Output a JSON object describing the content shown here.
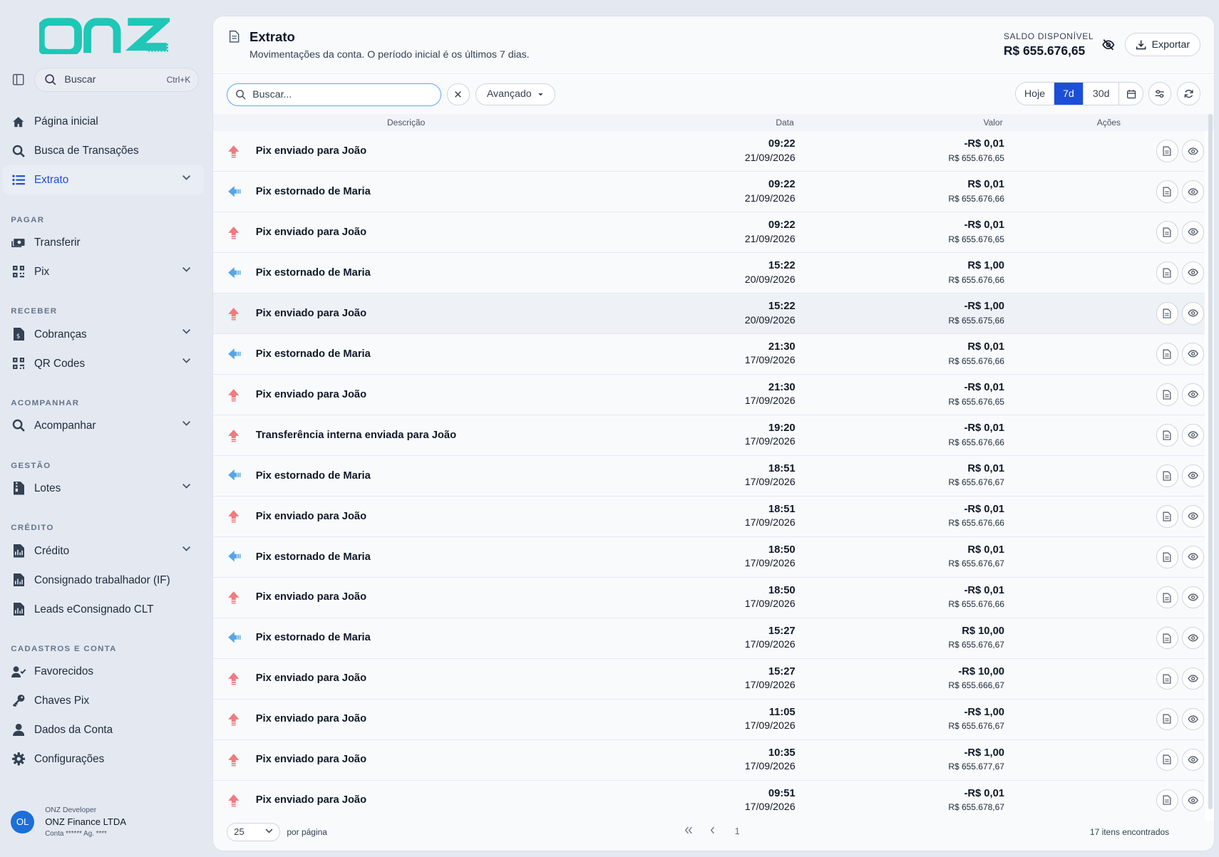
{
  "app": {
    "logo_text": "onz",
    "brand_color": "#1fc7b6",
    "accent_color": "#1d4ed8"
  },
  "sidebar": {
    "search_label": "Buscar",
    "search_shortcut": "Ctrl+K",
    "items_top": [
      {
        "label": "Página inicial",
        "icon": "home-icon"
      },
      {
        "label": "Busca de Transações",
        "icon": "search-icon"
      },
      {
        "label": "Extrato",
        "icon": "list-icon",
        "active": true,
        "expandable": true
      }
    ],
    "sections": [
      {
        "title": "PAGAR",
        "items": [
          {
            "label": "Transferir",
            "icon": "money-transfer-icon"
          },
          {
            "label": "Pix",
            "icon": "qr-grid-icon",
            "expandable": true
          }
        ]
      },
      {
        "title": "RECEBER",
        "items": [
          {
            "label": "Cobranças",
            "icon": "invoice-dollar-icon",
            "expandable": true
          },
          {
            "label": "QR Codes",
            "icon": "qrcode-icon",
            "expandable": true
          }
        ]
      },
      {
        "title": "ACOMPANHAR",
        "items": [
          {
            "label": "Acompanhar",
            "icon": "search-icon",
            "expandable": true
          }
        ]
      },
      {
        "title": "GESTÃO",
        "items": [
          {
            "label": "Lotes",
            "icon": "file-zip-icon",
            "expandable": true
          }
        ]
      },
      {
        "title": "CRÉDITO",
        "items": [
          {
            "label": "Crédito",
            "icon": "file-chart-icon",
            "expandable": true
          },
          {
            "label": "Consignado trabalhador (IF)",
            "icon": "file-chart-icon"
          },
          {
            "label": "Leads eConsignado CLT",
            "icon": "file-chart-icon"
          }
        ]
      },
      {
        "title": "CADASTROS E CONTA",
        "items": [
          {
            "label": "Favorecidos",
            "icon": "user-check-icon"
          },
          {
            "label": "Chaves Pix",
            "icon": "key-icon"
          },
          {
            "label": "Dados da Conta",
            "icon": "user-icon"
          },
          {
            "label": "Configurações",
            "icon": "gear-icon"
          }
        ]
      }
    ],
    "user": {
      "initials": "OL",
      "role": "ONZ Developer",
      "company": "ONZ Finance LTDA",
      "account": "Conta ****** Ag. ****"
    }
  },
  "header": {
    "title": "Extrato",
    "subtitle": "Movimentações da conta. O período inicial é os últimos 7 dias.",
    "balance_label": "SALDO DISPONÍVEL",
    "balance_value": "R$ 655.676,65",
    "export_label": "Exportar"
  },
  "toolbar": {
    "search_placeholder": "Buscar...",
    "advanced_label": "Avançado",
    "periods": [
      "Hoje",
      "7d",
      "30d"
    ],
    "selected_period": "7d"
  },
  "table": {
    "columns": [
      "Descrição",
      "Data",
      "Valor",
      "Ações"
    ],
    "rows": [
      {
        "direction": "out",
        "description": "Pix enviado para João",
        "time": "09:22",
        "date": "21/09/2026",
        "amount": "-R$ 0,01",
        "balance": "R$ 655.676,65"
      },
      {
        "direction": "in",
        "description": "Pix estornado de Maria",
        "time": "09:22",
        "date": "21/09/2026",
        "amount": "R$ 0,01",
        "balance": "R$ 655.676,66"
      },
      {
        "direction": "out",
        "description": "Pix enviado para João",
        "time": "09:22",
        "date": "21/09/2026",
        "amount": "-R$ 0,01",
        "balance": "R$ 655.676,65"
      },
      {
        "direction": "in",
        "description": "Pix estornado de Maria",
        "time": "15:22",
        "date": "20/09/2026",
        "amount": "R$ 1,00",
        "balance": "R$ 655.676,66"
      },
      {
        "direction": "out",
        "description": "Pix enviado para João",
        "time": "15:22",
        "date": "20/09/2026",
        "amount": "-R$ 1,00",
        "balance": "R$ 655.675,66",
        "highlighted": true
      },
      {
        "direction": "in",
        "description": "Pix estornado de Maria",
        "time": "21:30",
        "date": "17/09/2026",
        "amount": "R$ 0,01",
        "balance": "R$ 655.676,66"
      },
      {
        "direction": "out",
        "description": "Pix enviado para João",
        "time": "21:30",
        "date": "17/09/2026",
        "amount": "-R$ 0,01",
        "balance": "R$ 655.676,65"
      },
      {
        "direction": "out",
        "description": "Transferência interna enviada para João",
        "time": "19:20",
        "date": "17/09/2026",
        "amount": "-R$ 0,01",
        "balance": "R$ 655.676,66"
      },
      {
        "direction": "in",
        "description": "Pix estornado de Maria",
        "time": "18:51",
        "date": "17/09/2026",
        "amount": "R$ 0,01",
        "balance": "R$ 655.676,67"
      },
      {
        "direction": "out",
        "description": "Pix enviado para João",
        "time": "18:51",
        "date": "17/09/2026",
        "amount": "-R$ 0,01",
        "balance": "R$ 655.676,66"
      },
      {
        "direction": "in",
        "description": "Pix estornado de Maria",
        "time": "18:50",
        "date": "17/09/2026",
        "amount": "R$ 0,01",
        "balance": "R$ 655.676,67"
      },
      {
        "direction": "out",
        "description": "Pix enviado para João",
        "time": "18:50",
        "date": "17/09/2026",
        "amount": "-R$ 0,01",
        "balance": "R$ 655.676,66"
      },
      {
        "direction": "in",
        "description": "Pix estornado de Maria",
        "time": "15:27",
        "date": "17/09/2026",
        "amount": "R$ 10,00",
        "balance": "R$ 655.676,67"
      },
      {
        "direction": "out",
        "description": "Pix enviado para João",
        "time": "15:27",
        "date": "17/09/2026",
        "amount": "-R$ 10,00",
        "balance": "R$ 655.666,67"
      },
      {
        "direction": "out",
        "description": "Pix enviado para João",
        "time": "11:05",
        "date": "17/09/2026",
        "amount": "-R$ 1,00",
        "balance": "R$ 655.676,67"
      },
      {
        "direction": "out",
        "description": "Pix enviado para João",
        "time": "10:35",
        "date": "17/09/2026",
        "amount": "-R$ 1,00",
        "balance": "R$ 655.677,67"
      },
      {
        "direction": "out",
        "description": "Pix enviado para João",
        "time": "09:51",
        "date": "17/09/2026",
        "amount": "-R$ 0,01",
        "balance": "R$ 655.678,67"
      }
    ]
  },
  "footer": {
    "page_size": "25",
    "page_size_label": "por página",
    "current_page": "1",
    "total_label": "17 itens encontrados"
  },
  "colors": {
    "out_arrow": "#f07a7f",
    "in_arrow": "#55a6e6"
  }
}
